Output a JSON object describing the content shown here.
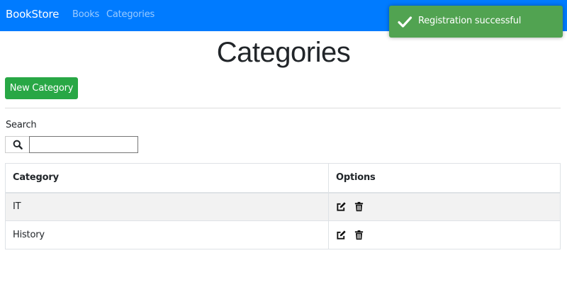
{
  "navbar": {
    "brand": "BookStore",
    "links": [
      "Books",
      "Categories"
    ],
    "background": "#007bff"
  },
  "toast": {
    "message": "Registration successful",
    "icon": "checkmark-icon",
    "background": "#51a351"
  },
  "page": {
    "title": "Categories",
    "new_button_label": "New Category",
    "new_button_color": "#28a745"
  },
  "search": {
    "label": "Search",
    "icon": "search-icon",
    "value": ""
  },
  "table": {
    "headers": [
      "Category",
      "Options"
    ],
    "rows": [
      {
        "category": "IT",
        "options": [
          "edit-icon",
          "trash-icon"
        ]
      },
      {
        "category": "History",
        "options": [
          "edit-icon",
          "trash-icon"
        ]
      }
    ]
  }
}
